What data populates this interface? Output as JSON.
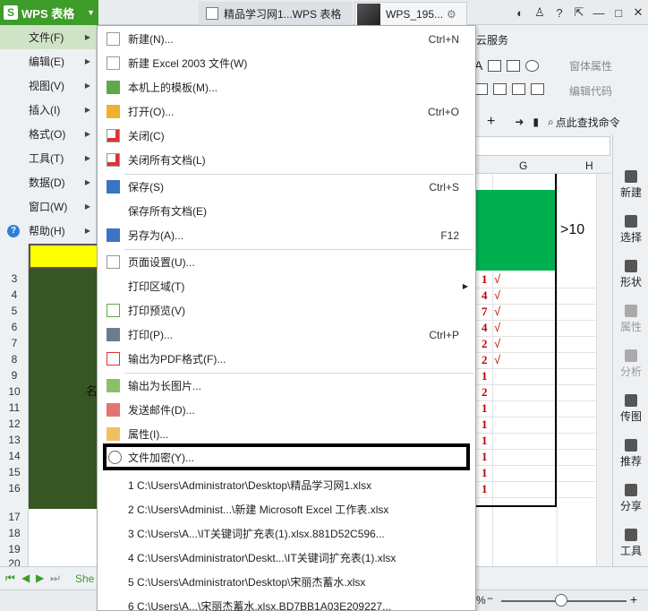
{
  "titlebar": {
    "app_name": "WPS 表格",
    "logo": "S",
    "tabs": [
      "精品学习网1...WPS 表格",
      "WPS_195..."
    ],
    "window_controls": [
      "restore-icon",
      "minimize-icon",
      "maximize-icon",
      "close-icon"
    ]
  },
  "left_menu": {
    "items": [
      {
        "label": "文件(F)",
        "active": true
      },
      {
        "label": "编辑(E)"
      },
      {
        "label": "视图(V)"
      },
      {
        "label": "插入(I)"
      },
      {
        "label": "格式(O)"
      },
      {
        "label": "工具(T)"
      },
      {
        "label": "数据(D)"
      },
      {
        "label": "窗口(W)"
      },
      {
        "label": "帮助(H)"
      }
    ]
  },
  "file_menu": {
    "items": [
      {
        "label": "新建(N)...",
        "shortcut": "Ctrl+N",
        "icon": "new-file-icon"
      },
      {
        "label": "新建 Excel 2003 文件(W)",
        "shortcut": "",
        "icon": "new-excel-icon"
      },
      {
        "label": "本机上的模板(M)...",
        "shortcut": "",
        "icon": "template-icon"
      },
      {
        "label": "打开(O)...",
        "shortcut": "Ctrl+O",
        "icon": "open-folder-icon"
      },
      {
        "label": "关闭(C)",
        "shortcut": "",
        "icon": "close-doc-icon"
      },
      {
        "label": "关闭所有文档(L)",
        "shortcut": "",
        "icon": "close-all-icon"
      },
      {
        "label": "保存(S)",
        "shortcut": "Ctrl+S",
        "icon": "save-icon"
      },
      {
        "label": "保存所有文档(E)",
        "shortcut": "",
        "icon": ""
      },
      {
        "label": "另存为(A)...",
        "shortcut": "F12",
        "icon": "save-as-icon"
      },
      {
        "label": "页面设置(U)...",
        "shortcut": "",
        "icon": "page-setup-icon"
      },
      {
        "label": "打印区域(T)",
        "shortcut": "",
        "icon": ""
      },
      {
        "label": "打印预览(V)",
        "shortcut": "",
        "icon": "print-preview-icon"
      },
      {
        "label": "打印(P)...",
        "shortcut": "Ctrl+P",
        "icon": "printer-icon"
      },
      {
        "label": "输出为PDF格式(F)...",
        "shortcut": "",
        "icon": "pdf-icon"
      },
      {
        "label": "输出为长图片...",
        "shortcut": "",
        "icon": "image-export-icon"
      },
      {
        "label": "发送邮件(D)...",
        "shortcut": "",
        "icon": "mail-icon"
      },
      {
        "label": "属性(I)...",
        "shortcut": "",
        "icon": "properties-icon"
      },
      {
        "label": "文件加密(Y)...",
        "shortcut": "",
        "icon": "encrypt-icon"
      }
    ],
    "recent": [
      "1 C:\\Users\\Administrator\\Desktop\\精品学习网1.xlsx",
      "2 C:\\Users\\Administ...\\新建 Microsoft Excel 工作表.xlsx",
      "3 C:\\Users\\A...\\IT关键词扩充表(1).xlsx.881D52C596...",
      "4 C:\\Users\\Administrator\\Deskt...\\IT关键词扩充表(1).xlsx",
      "5 C:\\Users\\Administrator\\Desktop\\宋丽杰蓄水.xlsx",
      "6 C:\\Users\\A...\\宋丽杰蓄水.xlsx.BD7BB1A03E209227..."
    ]
  },
  "ribbon": {
    "tab": "云服务",
    "letter_a": "A",
    "window_props": "窗体属性",
    "edit_code": "编辑代码",
    "find_command": "点此查找命令"
  },
  "sheet": {
    "row_numbers": [
      "3",
      "4",
      "5",
      "6",
      "7",
      "8",
      "9",
      "10",
      "11",
      "12",
      "13",
      "14",
      "15",
      "16",
      "17",
      "18",
      "19",
      "20"
    ],
    "col_g": "G",
    "col_h": "H",
    "header_text": ">10",
    "name_char": "名",
    "values": [
      "1",
      "4",
      "7",
      "4",
      "2",
      "2",
      "1",
      "2",
      "1",
      "1",
      "1",
      "1",
      "1",
      "1"
    ],
    "checks": [
      "√",
      "√",
      "√",
      "√",
      "√",
      "√",
      "",
      "",
      "",
      "",
      "",
      "",
      "",
      ""
    ],
    "sheet_tab": "She",
    "zoom_pct": "%"
  },
  "side_pane": {
    "items": [
      {
        "label": "新建",
        "dim": false
      },
      {
        "label": "选择",
        "dim": false
      },
      {
        "label": "形状",
        "dim": false
      },
      {
        "label": "属性",
        "dim": true
      },
      {
        "label": "分析",
        "dim": true
      },
      {
        "label": "传图",
        "dim": false
      },
      {
        "label": "推荐",
        "dim": false
      },
      {
        "label": "分享",
        "dim": false
      },
      {
        "label": "工具",
        "dim": false
      }
    ]
  }
}
